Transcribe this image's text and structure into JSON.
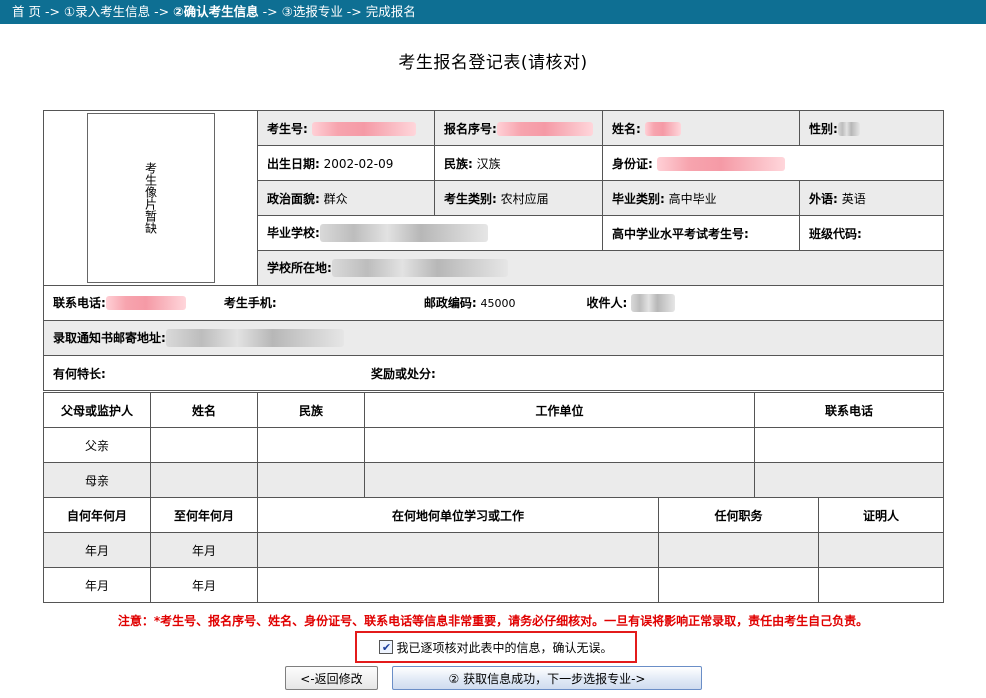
{
  "breadcrumb": {
    "home": "首 页",
    "sep1": " -> ",
    "step1": "①录入考生信息",
    "sep2": " -> ",
    "step2": "②确认考生信息",
    "sep3": " -> ",
    "step3": "③选报专业",
    "sep4": " -> ",
    "step4": "完成报名"
  },
  "title": "考生报名登记表(请核对)",
  "photo_placeholder": "考生像片暂缺",
  "fields": {
    "exam_no_label": "考生号:",
    "reg_no_label": "报名序号:",
    "name_label": "姓名:",
    "gender_label": "性别:",
    "birth_label": "出生日期:",
    "birth_value": "2002-02-09",
    "nation_label": "民族:",
    "nation_value": "汉族",
    "id_label": "身份证:",
    "political_label": "政治面貌:",
    "political_value": "群众",
    "category_label": "考生类别:",
    "category_value": "农村应届",
    "grad_type_label": "毕业类别:",
    "grad_type_value": "高中毕业",
    "lang_label": "外语:",
    "lang_value": "英语",
    "school_label": "毕业学校:",
    "hs_exam_label": "高中学业水平考试考生号:",
    "class_label": "班级代码:",
    "school_loc_label": "学校所在地:",
    "phone_label": "联系电话:",
    "mobile_label": "考生手机:",
    "zip_label": "邮政编码:",
    "zip_value": "45000",
    "receiver_label": "收件人:",
    "address_label": "录取通知书邮寄地址:",
    "specialty_label": "有何特长:",
    "reward_label": "奖励或处分:"
  },
  "family": {
    "headers": [
      "父母或监护人",
      "姓名",
      "民族",
      "工作单位",
      "联系电话"
    ],
    "rows": [
      "父亲",
      "母亲"
    ]
  },
  "resume": {
    "headers": [
      "自何年何月",
      "至何年何月",
      "在何地何单位学习或工作",
      "任何职务",
      "证明人"
    ],
    "rows": [
      {
        "from": "年月",
        "to": "年月"
      },
      {
        "from": "年月",
        "to": "年月"
      }
    ]
  },
  "notice": "注意：*考生号、报名序号、姓名、身份证号、联系电话等信息非常重要，请务必仔细核对。一旦有误将影响正常录取，责任由考生自己负责。",
  "confirm_text": "我已逐项核对此表中的信息，确认无误。",
  "back_button": "<-返回修改",
  "next_button": "② 获取信息成功，下一步选报专业->",
  "colors": {
    "topbar": "#0e6f93",
    "notice": "#e00000",
    "highlight_border": "#e31b1b"
  }
}
